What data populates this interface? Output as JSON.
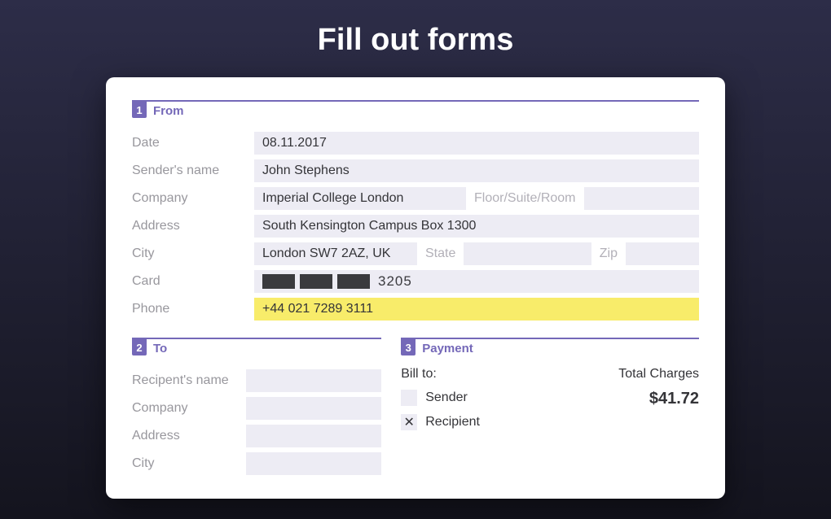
{
  "title": "Fill out forms",
  "sections": {
    "from": {
      "num": "1",
      "title": "From",
      "date_label": "Date",
      "date_value": "08.11.2017",
      "sender_label": "Sender's name",
      "sender_value": "John Stephens",
      "company_label": "Company",
      "company_value": "Imperial College London",
      "floor_placeholder": "Floor/Suite/Room",
      "address_label": "Address",
      "address_value": "South Kensington Campus Box 1300",
      "city_label": "City",
      "city_value": "London SW7 2AZ, UK",
      "state_placeholder": "State",
      "zip_placeholder": "Zip",
      "card_label": "Card",
      "card_visible": "3205",
      "phone_label": "Phone",
      "phone_value": "+44 021 7289 3111"
    },
    "to": {
      "num": "2",
      "title": "To",
      "recipient_label": "Recipent's name",
      "company_label": "Company",
      "address_label": "Address",
      "city_label": "City"
    },
    "payment": {
      "num": "3",
      "title": "Payment",
      "bill_label": "Bill to:",
      "sender_option": "Sender",
      "recipient_option": "Recipient",
      "total_label": "Total  Charges",
      "total_value": "$41.72",
      "recipient_checked": true,
      "sender_checked": false
    }
  }
}
